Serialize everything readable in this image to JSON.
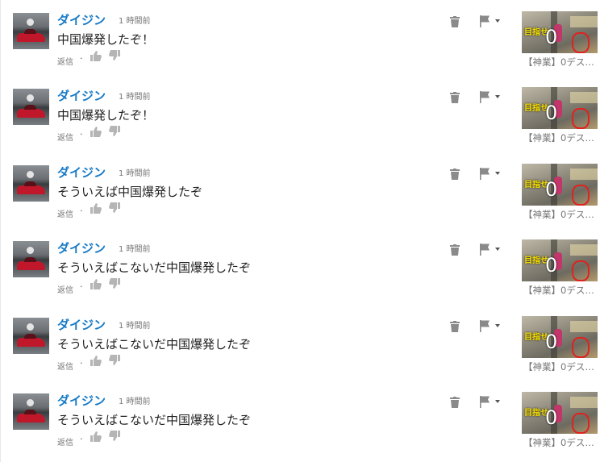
{
  "comments": [
    {
      "author": "ダイジン",
      "time": "1 時間前",
      "text": "中国爆発したぞ！",
      "reply": "返信",
      "video_title": "【神業】0デス…",
      "thumb_label": "目指せ",
      "thumb_count": "0"
    },
    {
      "author": "ダイジン",
      "time": "1 時間前",
      "text": "中国爆発したぞ！",
      "reply": "返信",
      "video_title": "【神業】0デス…",
      "thumb_label": "目指せ",
      "thumb_count": "0"
    },
    {
      "author": "ダイジン",
      "time": "1 時間前",
      "text": "そういえば中国爆発したぞ",
      "reply": "返信",
      "video_title": "【神業】0デス…",
      "thumb_label": "目指せ",
      "thumb_count": "0"
    },
    {
      "author": "ダイジン",
      "time": "1 時間前",
      "text": "そういえばこないだ中国爆発したぞ",
      "reply": "返信",
      "video_title": "【神業】0デス…",
      "thumb_label": "目指せ",
      "thumb_count": "0"
    },
    {
      "author": "ダイジン",
      "time": "1 時間前",
      "text": "そういえばこないだ中国爆発したぞ",
      "reply": "返信",
      "video_title": "【神業】0デス…",
      "thumb_label": "目指せ",
      "thumb_count": "0"
    },
    {
      "author": "ダイジン",
      "time": "1 時間前",
      "text": "そういえばこないだ中国爆発したぞ",
      "reply": "返信",
      "video_title": "【神業】0デス…",
      "thumb_label": "目指せ",
      "thumb_count": "0"
    }
  ],
  "colors": {
    "author": "#167ac6",
    "meta": "#767676",
    "text": "#222222",
    "icon": "#909090"
  },
  "icons": {
    "like": "thumbs-up-icon",
    "dislike": "thumbs-down-icon",
    "delete": "trash-icon",
    "flag": "flag-icon"
  }
}
